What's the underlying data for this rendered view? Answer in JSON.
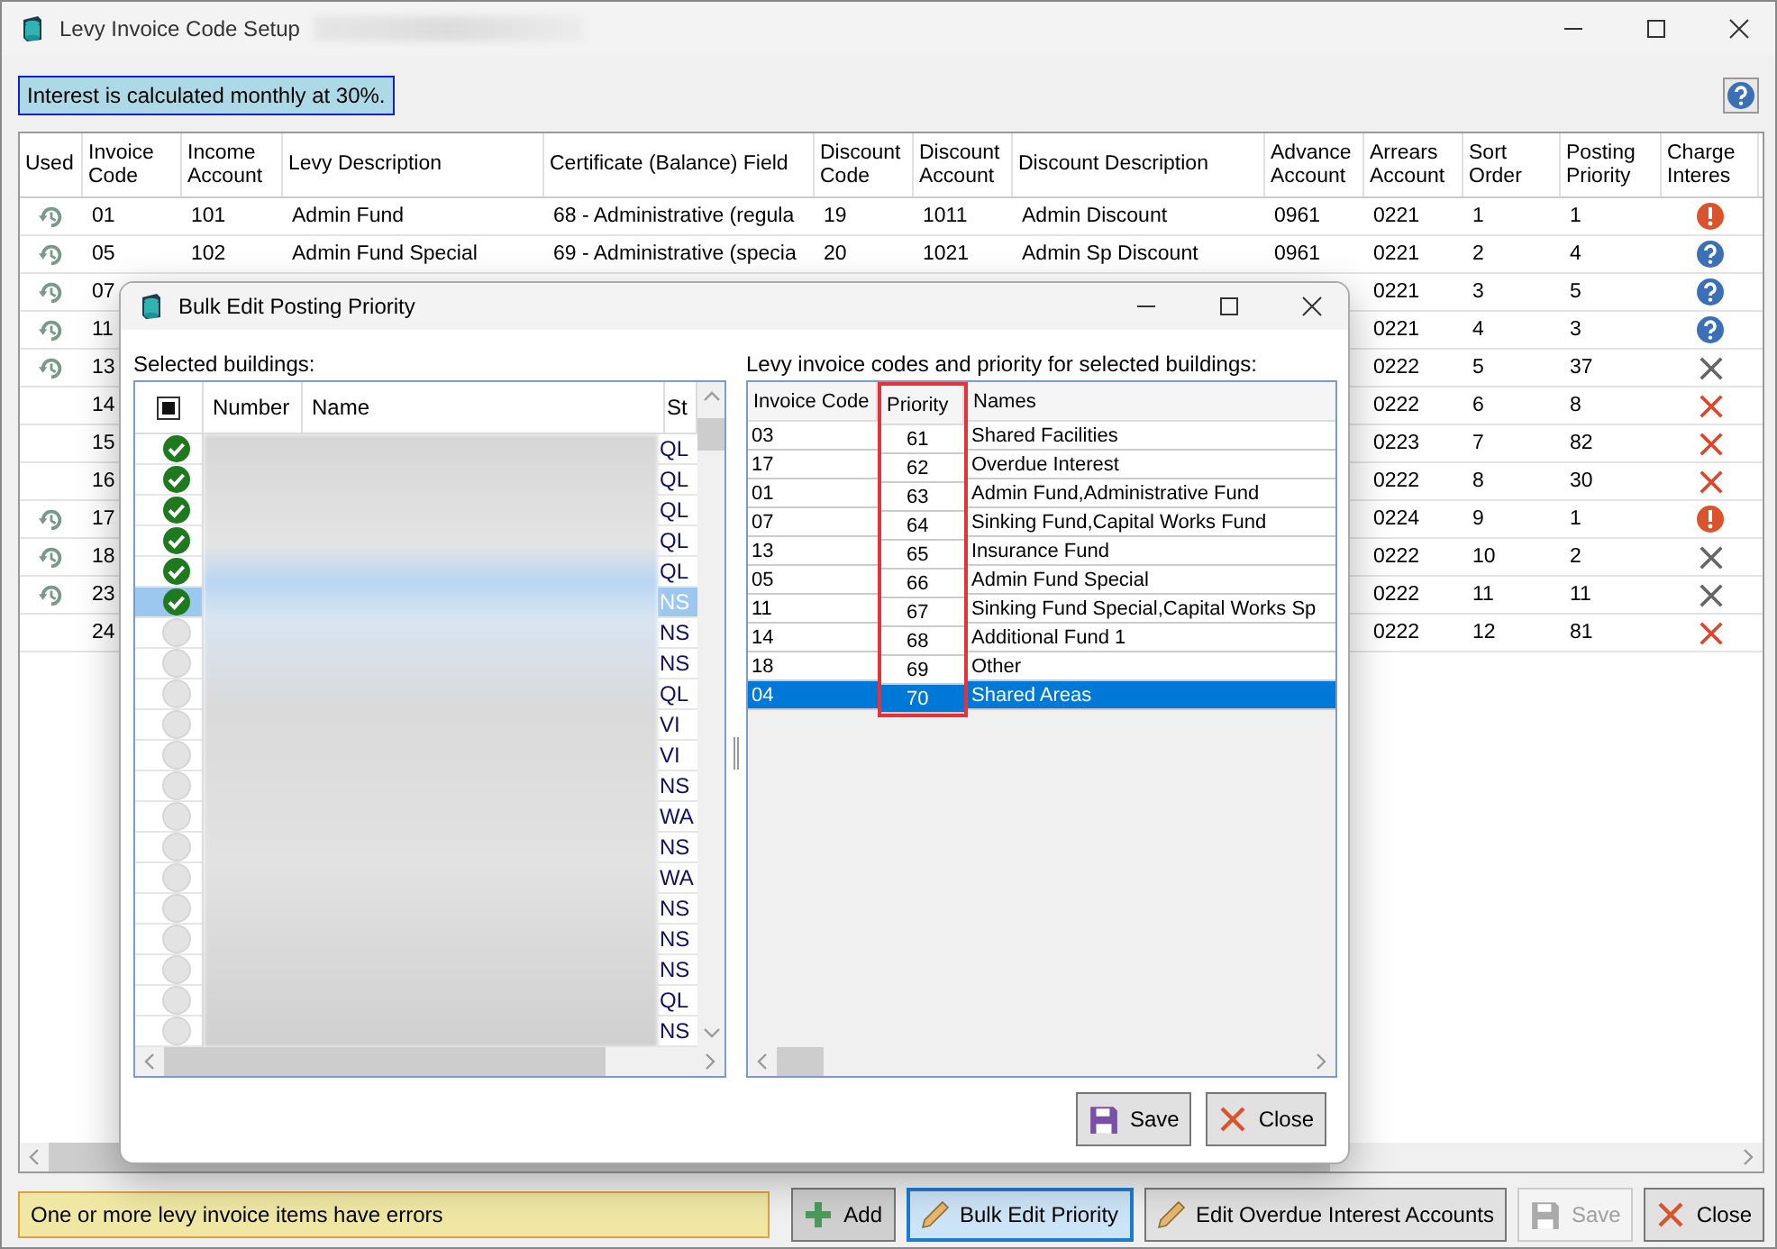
{
  "window": {
    "title": "Levy Invoice Code Setup"
  },
  "info_banner": "Interest is calculated monthly at 30%.",
  "table": {
    "columns": [
      "Used",
      "Invoice Code",
      "Income Account",
      "Levy Description",
      "Certificate (Balance) Field",
      "Discount Code",
      "Discount Account",
      "Discount Description",
      "Advance Account",
      "Arrears Account",
      "Sort Order",
      "Posting Priority",
      "Charge Interes"
    ],
    "rows": [
      {
        "used": true,
        "invoice_code": "01",
        "income_account": "101",
        "levy_description": "Admin Fund",
        "certificate_field": "68 - Administrative (regula",
        "discount_code": "19",
        "discount_account": "1011",
        "discount_description": "Admin Discount",
        "advance_account": "0961",
        "arrears_account": "0221",
        "sort_order": "1",
        "posting_priority": "1",
        "charge_interest": {
          "kind": "warning"
        }
      },
      {
        "used": true,
        "invoice_code": "05",
        "income_account": "102",
        "levy_description": "Admin Fund Special",
        "certificate_field": "69 - Administrative (specia",
        "discount_code": "20",
        "discount_account": "1021",
        "discount_description": "Admin Sp Discount",
        "advance_account": "0961",
        "arrears_account": "0221",
        "sort_order": "2",
        "posting_priority": "4",
        "charge_interest": {
          "kind": "question"
        }
      },
      {
        "used": true,
        "invoice_code": "07",
        "arrears_account": "0221",
        "sort_order": "3",
        "posting_priority": "5",
        "charge_interest": {
          "kind": "question"
        }
      },
      {
        "used": true,
        "invoice_code": "11",
        "arrears_account": "0221",
        "sort_order": "4",
        "posting_priority": "3",
        "charge_interest": {
          "kind": "question"
        }
      },
      {
        "used": true,
        "invoice_code": "13",
        "arrears_account": "0222",
        "sort_order": "5",
        "posting_priority": "37",
        "charge_interest": {
          "kind": "gray-cross"
        }
      },
      {
        "used": false,
        "invoice_code": "14",
        "arrears_account": "0222",
        "sort_order": "6",
        "posting_priority": "8",
        "charge_interest": {
          "kind": "red-cross"
        }
      },
      {
        "used": false,
        "invoice_code": "15",
        "arrears_account": "0223",
        "sort_order": "7",
        "posting_priority": "82",
        "charge_interest": {
          "kind": "red-cross"
        }
      },
      {
        "used": false,
        "invoice_code": "16",
        "arrears_account": "0222",
        "sort_order": "8",
        "posting_priority": "30",
        "charge_interest": {
          "kind": "red-cross"
        }
      },
      {
        "used": true,
        "invoice_code": "17",
        "arrears_account": "0224",
        "sort_order": "9",
        "posting_priority": "1",
        "charge_interest": {
          "kind": "warning"
        }
      },
      {
        "used": true,
        "invoice_code": "18",
        "arrears_account": "0222",
        "sort_order": "10",
        "posting_priority": "2",
        "charge_interest": {
          "kind": "gray-cross"
        }
      },
      {
        "used": true,
        "invoice_code": "23",
        "arrears_account": "0222",
        "sort_order": "11",
        "posting_priority": "11",
        "charge_interest": {
          "kind": "gray-cross"
        }
      },
      {
        "used": false,
        "invoice_code": "24",
        "arrears_account": "0222",
        "sort_order": "12",
        "posting_priority": "81",
        "charge_interest": {
          "kind": "red-cross"
        }
      }
    ]
  },
  "dialog": {
    "title": "Bulk Edit Posting Priority",
    "buildings_label": "Selected buildings:",
    "select_all": {
      "kind": "mixed"
    },
    "buildings_columns": [
      "Number",
      "Name",
      "St"
    ],
    "buildings": [
      {
        "checked": true,
        "selected": false,
        "state": "QL"
      },
      {
        "checked": true,
        "selected": false,
        "state": "QL"
      },
      {
        "checked": true,
        "selected": false,
        "state": "QL"
      },
      {
        "checked": true,
        "selected": false,
        "state": "QL"
      },
      {
        "checked": true,
        "selected": false,
        "state": "QL"
      },
      {
        "checked": true,
        "selected": true,
        "state": "NS"
      },
      {
        "checked": false,
        "selected": false,
        "state": "NS"
      },
      {
        "checked": false,
        "selected": false,
        "state": "NS"
      },
      {
        "checked": false,
        "selected": false,
        "state": "QL"
      },
      {
        "checked": false,
        "selected": false,
        "state": "VI"
      },
      {
        "checked": false,
        "selected": false,
        "state": "VI"
      },
      {
        "checked": false,
        "selected": false,
        "state": "NS"
      },
      {
        "checked": false,
        "selected": false,
        "state": "WA"
      },
      {
        "checked": false,
        "selected": false,
        "state": "NS"
      },
      {
        "checked": false,
        "selected": false,
        "state": "WA"
      },
      {
        "checked": false,
        "selected": false,
        "state": "NS"
      },
      {
        "checked": false,
        "selected": false,
        "state": "NS"
      },
      {
        "checked": false,
        "selected": false,
        "state": "NS"
      },
      {
        "checked": false,
        "selected": false,
        "state": "QL"
      },
      {
        "checked": false,
        "selected": false,
        "state": "NS"
      }
    ],
    "codes_label": "Levy invoice codes and priority for selected buildings:",
    "codes_columns": [
      {
        "label": "Invoice Code",
        "highlighted": false
      },
      {
        "label": "Priority",
        "highlighted": true
      },
      {
        "label": "Names",
        "highlighted": false
      }
    ],
    "codes": [
      {
        "code": "03",
        "priority": "61",
        "names": "Shared Facilities",
        "selected": false
      },
      {
        "code": "17",
        "priority": "62",
        "names": "Overdue Interest",
        "selected": false
      },
      {
        "code": "01",
        "priority": "63",
        "names": "Admin Fund,Administrative Fund",
        "selected": false
      },
      {
        "code": "07",
        "priority": "64",
        "names": "Sinking Fund,Capital Works Fund",
        "selected": false
      },
      {
        "code": "13",
        "priority": "65",
        "names": "Insurance Fund",
        "selected": false
      },
      {
        "code": "05",
        "priority": "66",
        "names": "Admin Fund Special",
        "selected": false
      },
      {
        "code": "11",
        "priority": "67",
        "names": "Sinking Fund Special,Capital Works Sp",
        "selected": false
      },
      {
        "code": "14",
        "priority": "68",
        "names": "Additional Fund 1",
        "selected": false
      },
      {
        "code": "18",
        "priority": "69",
        "names": "Other",
        "selected": false
      },
      {
        "code": "04",
        "priority": "70",
        "names": "Shared Areas",
        "selected": true
      }
    ],
    "buttons": [
      {
        "label": "Save",
        "kind": "save"
      },
      {
        "label": "Close",
        "kind": "close"
      }
    ]
  },
  "status_message": "One or more levy invoice items have errors",
  "buttons": [
    {
      "label": "Add",
      "kind": "add",
      "focused": false,
      "disabled": false
    },
    {
      "label": "Bulk Edit Priority",
      "kind": "edit",
      "focused": true,
      "disabled": false
    },
    {
      "label": "Edit Overdue Interest Accounts",
      "kind": "edit",
      "focused": false,
      "disabled": false
    },
    {
      "label": "Save",
      "kind": "save",
      "focused": false,
      "disabled": true
    },
    {
      "label": "Close",
      "kind": "close",
      "focused": false,
      "disabled": false
    }
  ]
}
